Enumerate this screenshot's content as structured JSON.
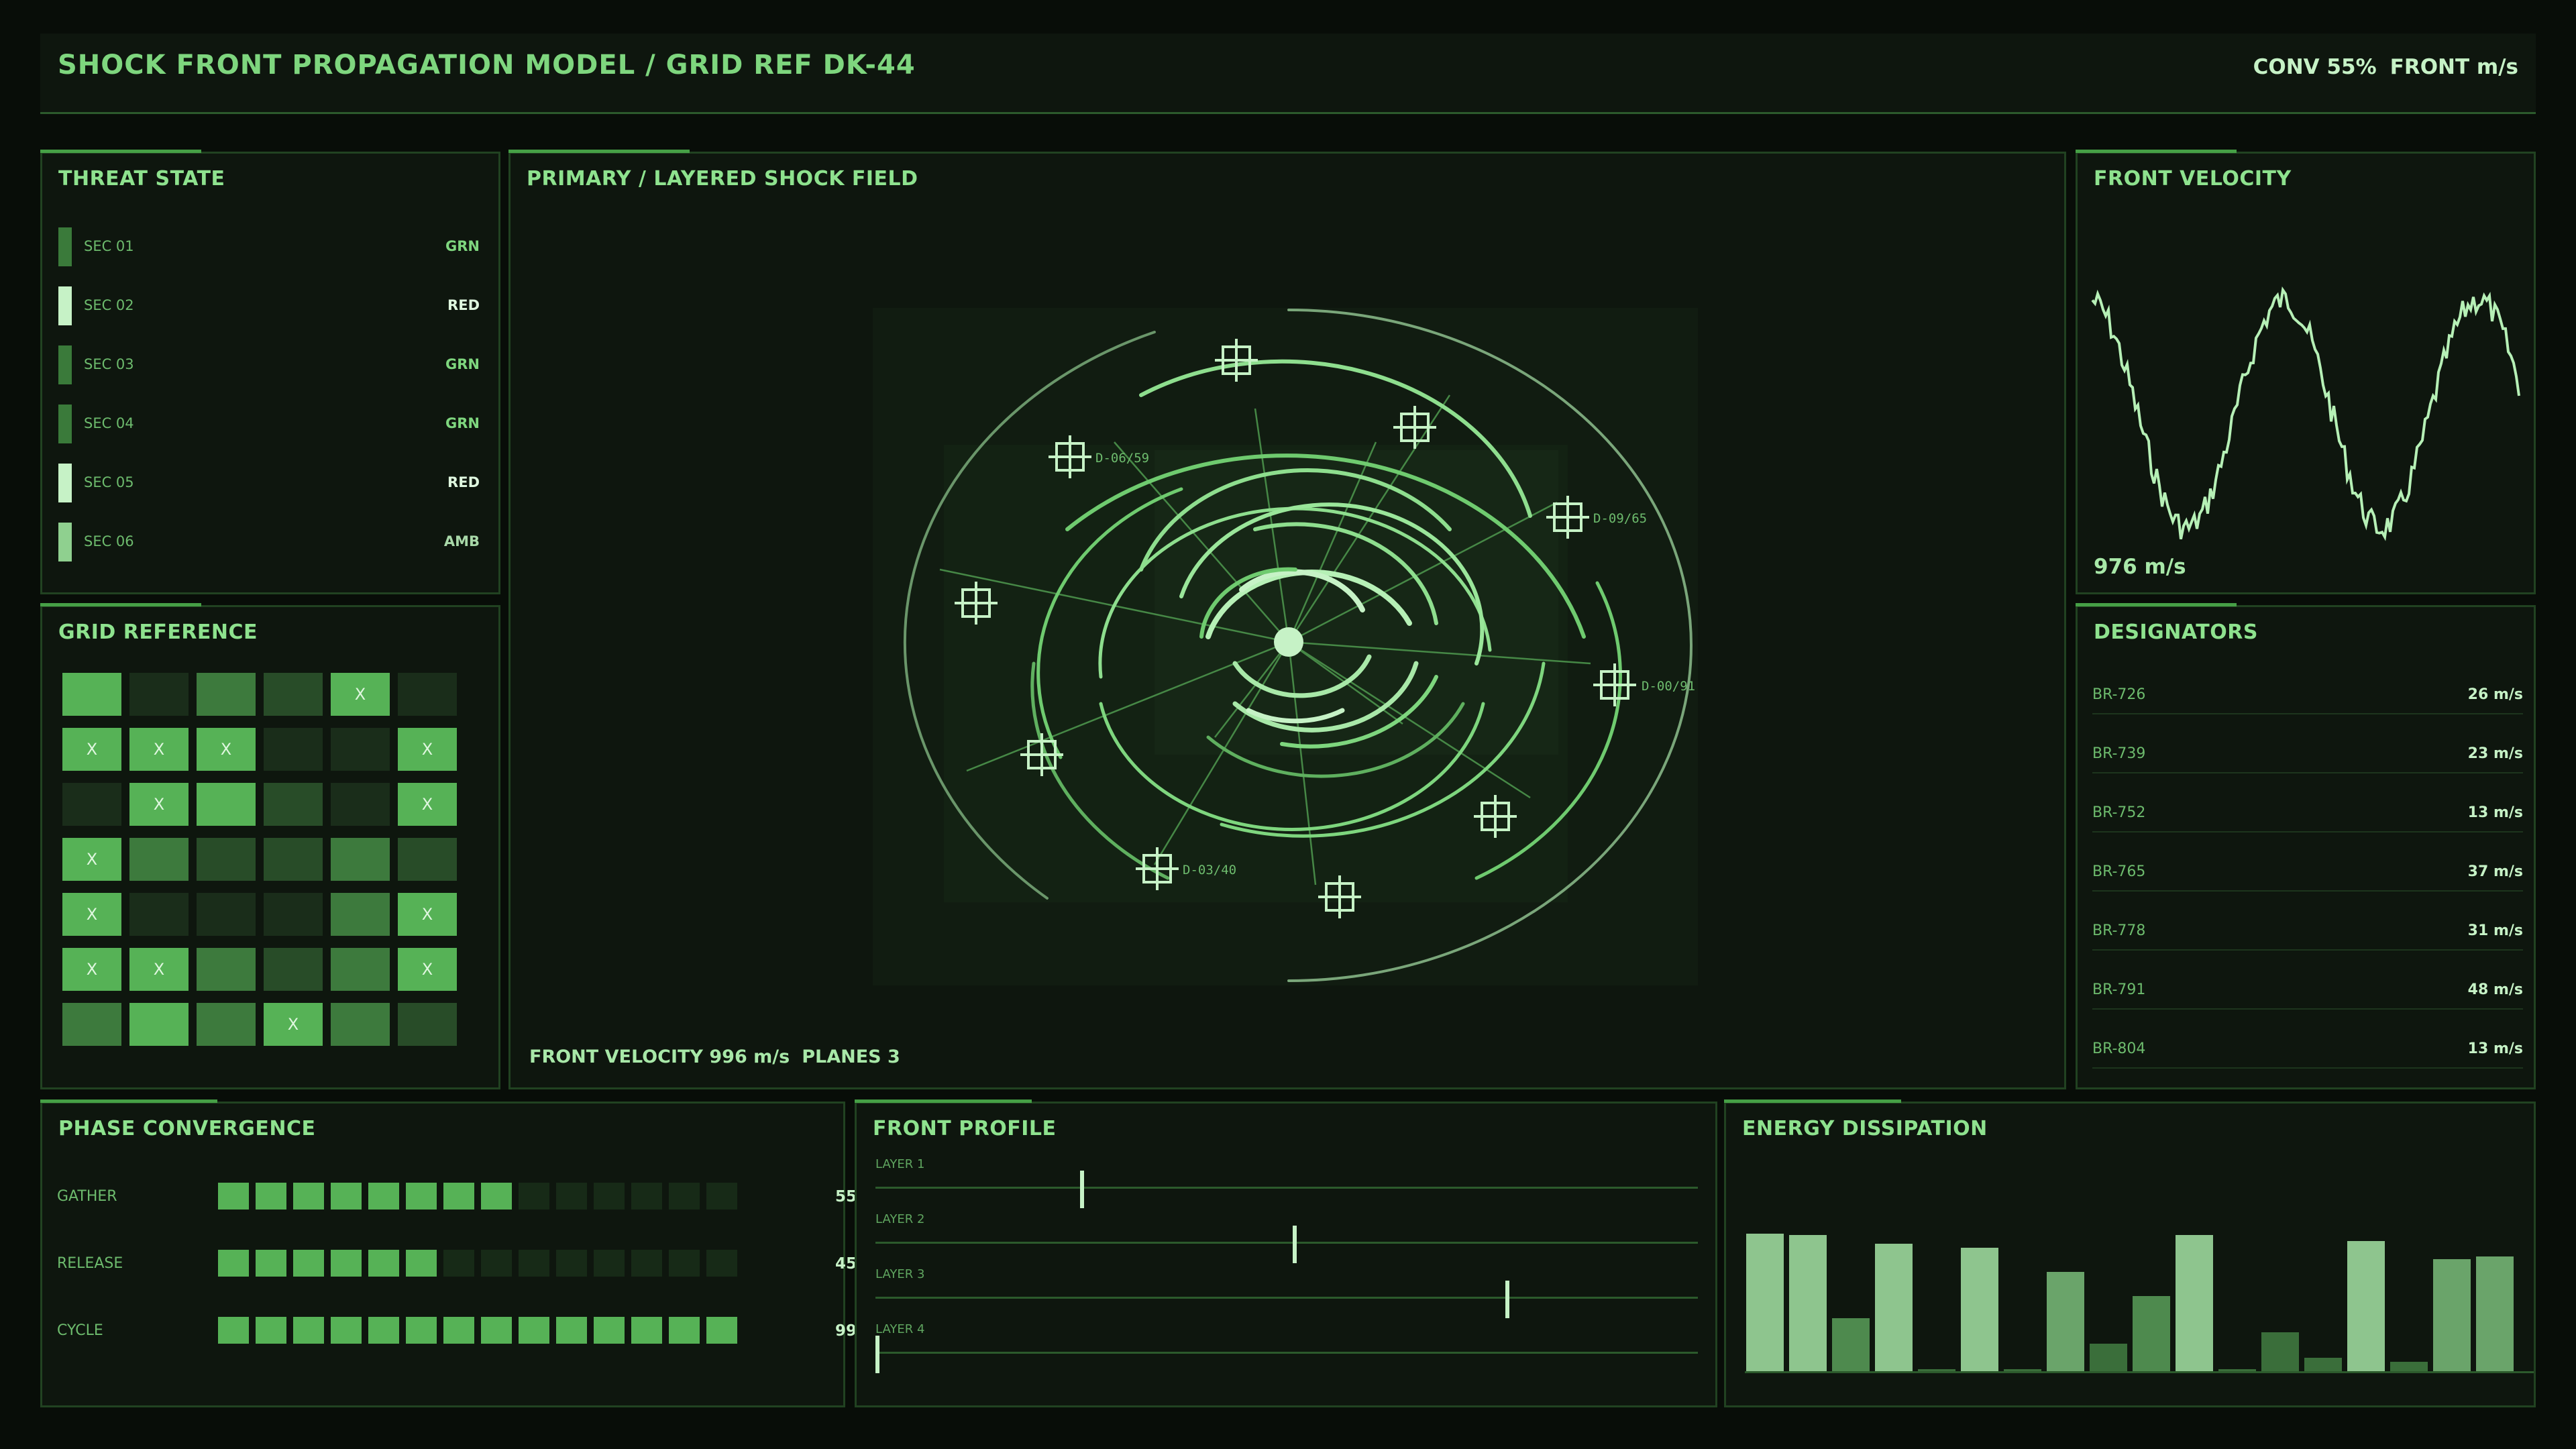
{
  "header": {
    "title": "SHOCK FRONT PROPAGATION MODEL / GRID REF DK-44",
    "conv": "CONV 55%",
    "front_unit": "FRONT m/s"
  },
  "threat": {
    "title": "THREAT STATE",
    "items": [
      {
        "label": "SEC 01",
        "value": "GRN"
      },
      {
        "label": "SEC 02",
        "value": "RED"
      },
      {
        "label": "SEC 03",
        "value": "GRN"
      },
      {
        "label": "SEC 04",
        "value": "GRN"
      },
      {
        "label": "SEC 05",
        "value": "RED"
      },
      {
        "label": "SEC 06",
        "value": "AMB"
      }
    ]
  },
  "grid": {
    "title": "GRID REFERENCE",
    "mark": "X",
    "cells": [
      [
        {
          "lvl": 3,
          "x": false
        },
        {
          "lvl": 0,
          "x": false
        },
        {
          "lvl": 2,
          "x": false
        },
        {
          "lvl": 1,
          "x": false
        },
        {
          "lvl": 3,
          "x": true
        },
        {
          "lvl": 0,
          "x": false
        }
      ],
      [
        {
          "lvl": 3,
          "x": true
        },
        {
          "lvl": 3,
          "x": true
        },
        {
          "lvl": 3,
          "x": true
        },
        {
          "lvl": 0,
          "x": false
        },
        {
          "lvl": 0,
          "x": false
        },
        {
          "lvl": 3,
          "x": true
        }
      ],
      [
        {
          "lvl": 0,
          "x": false
        },
        {
          "lvl": 3,
          "x": true
        },
        {
          "lvl": 3,
          "x": false
        },
        {
          "lvl": 1,
          "x": false
        },
        {
          "lvl": 0,
          "x": false
        },
        {
          "lvl": 3,
          "x": true
        }
      ],
      [
        {
          "lvl": 3,
          "x": true
        },
        {
          "lvl": 2,
          "x": false
        },
        {
          "lvl": 1,
          "x": false
        },
        {
          "lvl": 1,
          "x": false
        },
        {
          "lvl": 2,
          "x": false
        },
        {
          "lvl": 1,
          "x": false
        }
      ],
      [
        {
          "lvl": 3,
          "x": true
        },
        {
          "lvl": 0,
          "x": false
        },
        {
          "lvl": 0,
          "x": false
        },
        {
          "lvl": 0,
          "x": false
        },
        {
          "lvl": 2,
          "x": false
        },
        {
          "lvl": 3,
          "x": true
        }
      ],
      [
        {
          "lvl": 3,
          "x": true
        },
        {
          "lvl": 3,
          "x": true
        },
        {
          "lvl": 2,
          "x": false
        },
        {
          "lvl": 1,
          "x": false
        },
        {
          "lvl": 2,
          "x": false
        },
        {
          "lvl": 3,
          "x": true
        }
      ],
      [
        {
          "lvl": 2,
          "x": false
        },
        {
          "lvl": 3,
          "x": false
        },
        {
          "lvl": 2,
          "x": false
        },
        {
          "lvl": 3,
          "x": true
        },
        {
          "lvl": 2,
          "x": false
        },
        {
          "lvl": 1,
          "x": false
        }
      ]
    ]
  },
  "main": {
    "title": "PRIMARY / LAYERED SHOCK FIELD",
    "front_velocity": "FRONT VELOCITY 996 m/s",
    "planes": "PLANES 3",
    "marker_labels": [
      "D-06/59",
      "D-09/65",
      "D-00/91",
      "D-03/40"
    ]
  },
  "velocity": {
    "title": "FRONT VELOCITY",
    "readout": "976 m/s"
  },
  "designators": {
    "title": "DESIGNATORS",
    "items": [
      {
        "id": "BR-726",
        "value": "26 m/s"
      },
      {
        "id": "BR-739",
        "value": "23 m/s"
      },
      {
        "id": "BR-752",
        "value": "13 m/s"
      },
      {
        "id": "BR-765",
        "value": "37 m/s"
      },
      {
        "id": "BR-778",
        "value": "31 m/s"
      },
      {
        "id": "BR-791",
        "value": "48 m/s"
      },
      {
        "id": "BR-804",
        "value": "13 m/s"
      }
    ]
  },
  "phase": {
    "title": "PHASE CONVERGENCE",
    "items": [
      {
        "label": "GATHER",
        "value": 55,
        "display": "55"
      },
      {
        "label": "RELEASE",
        "value": 45,
        "display": "45"
      },
      {
        "label": "CYCLE",
        "value": 99,
        "display": "99"
      }
    ]
  },
  "profile": {
    "title": "FRONT PROFILE",
    "layers": [
      {
        "label": "LAYER 1",
        "position": 0.25
      },
      {
        "label": "LAYER 2",
        "position": 0.51
      },
      {
        "label": "LAYER 3",
        "position": 0.77
      },
      {
        "label": "LAYER 4",
        "position": 0.0
      }
    ]
  },
  "energy": {
    "title": "ENERGY DISSIPATION",
    "values": [
      0.98,
      0.97,
      0.38,
      0.91,
      0.02,
      0.88,
      0.0,
      0.71,
      0.2,
      0.54,
      0.97,
      0.01,
      0.28,
      0.1,
      0.93,
      0.07,
      0.8,
      0.82
    ]
  },
  "colors": {
    "accent": "#7ed67e",
    "bright": "#c6f2c6",
    "dim": "#2c5a2c",
    "status_grn": "#7ed67e",
    "status_red": "#dff7df",
    "status_amb": "#a8d8a8"
  }
}
